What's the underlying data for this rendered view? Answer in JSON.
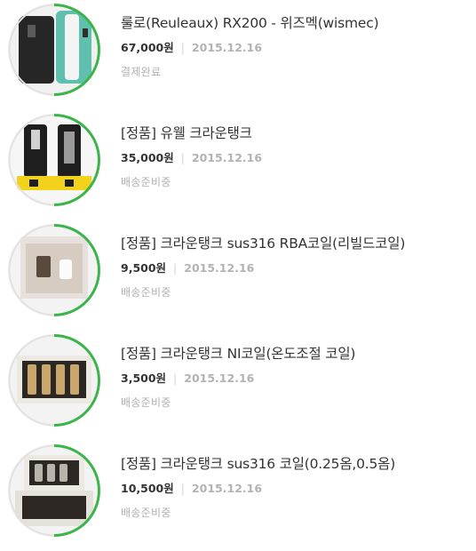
{
  "orders": [
    {
      "title": "룰로(Reuleaux) RX200 - 위즈멕(wismec)",
      "price": "67,000원",
      "date": "2015.12.16",
      "status": "결제완료",
      "image": "reuleaux-mod-product"
    },
    {
      "title": "[정품] 유웰 크라운탱크",
      "price": "35,000원",
      "date": "2015.12.16",
      "status": "배송준비중",
      "image": "crown-tank-product"
    },
    {
      "title": "[정품] 크라운탱크 sus316 RBA코일(리빌드코일)",
      "price": "9,500원",
      "date": "2015.12.16",
      "status": "배송준비중",
      "image": "rba-coil-product"
    },
    {
      "title": "[정품] 크라운탱크 NI코일(온도조절 코일)",
      "price": "3,500원",
      "date": "2015.12.16",
      "status": "배송준비중",
      "image": "ni-coil-product"
    },
    {
      "title": "[정품] 크라운탱크 sus316 코일(0.25옴,0.5옴)",
      "price": "10,500원",
      "date": "2015.12.16",
      "status": "배송준비중",
      "image": "sus316-coil-product"
    }
  ],
  "colors": {
    "accent": "#3bb54a",
    "ring_gray": "#e2e2e2",
    "title": "#333333",
    "muted": "#b3b3b3"
  }
}
